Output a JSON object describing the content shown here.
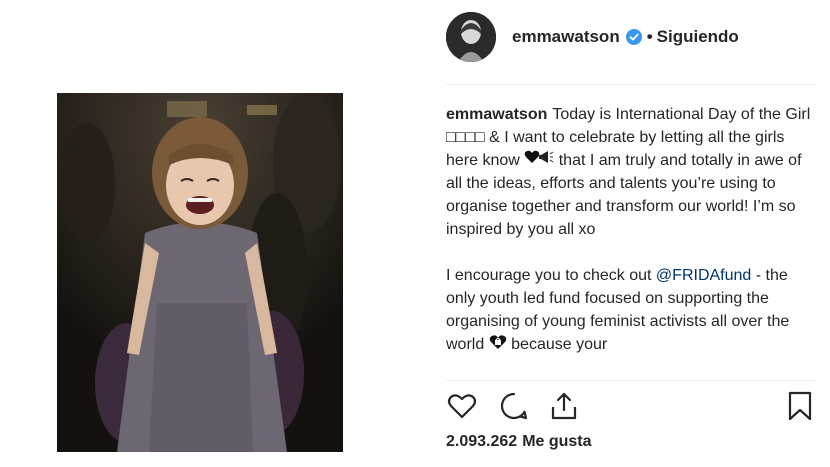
{
  "post": {
    "username": "emmawatson",
    "separator": "•",
    "follow_label": "Siguiendo",
    "likes_count": "2.093.262",
    "likes_label": "Me gusta"
  },
  "caption": {
    "username": "emmawatson",
    "para1_a": "Today is International Day of the Girl",
    "para1_glyphs": "□□□□",
    "para1_b": "& I want to celebrate by letting all the girls here know",
    "para1_c": "that I am truly and totally in awe of all the ideas, efforts and talents you’re using to organise together and transform our world! I’m so inspired by you all xo",
    "para2_a": "I encourage you to check out",
    "mention": "@FRIDAfund",
    "para2_b": "- the only youth led fund focused on supporting the organising of young feminist activists all over the world",
    "para2_c": "because your"
  },
  "icons": {
    "verified": "verified-badge-icon",
    "like": "heart-icon",
    "comment": "comment-icon",
    "share": "share-icon",
    "save": "bookmark-icon",
    "emoji_heart_megaphone": "black-heart-megaphone-emoji",
    "emoji_heart_lock": "heart-lock-emoji"
  },
  "colors": {
    "verified_blue": "#3897f0",
    "mention": "#003569",
    "text": "#262626"
  }
}
